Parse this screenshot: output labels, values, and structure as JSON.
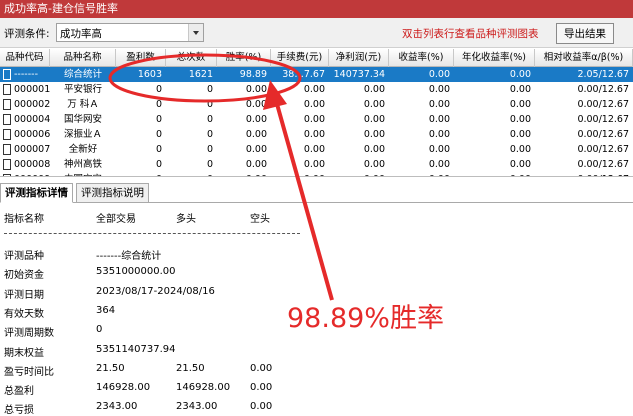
{
  "window": {
    "title": "成功率高-建仓信号胜率"
  },
  "toolbar": {
    "condition_label": "评测条件:",
    "condition_value": "成功率高",
    "hint": "双击列表行查看品种评测图表",
    "export_label": "导出结果"
  },
  "grid": {
    "headers": [
      "品种代码",
      "品种名称",
      "盈利数",
      "总次数",
      "胜率(%)",
      "手续费(元)",
      "净利润(元)",
      "收益率(%)",
      "年化收益率(%)",
      "相对收益率α/β(%)"
    ],
    "rows": [
      [
        "-------",
        "综合统计",
        "1603",
        "1621",
        "98.89",
        "38…7.67",
        "140737.34",
        "0.00",
        "0.00",
        "2.05/12.67"
      ],
      [
        "000001",
        "平安银行",
        "0",
        "0",
        "0.00",
        "0.00",
        "0.00",
        "0.00",
        "0.00",
        "0.00/12.67"
      ],
      [
        "000002",
        "万 科Ａ",
        "0",
        "0",
        "0.00",
        "0.00",
        "0.00",
        "0.00",
        "0.00",
        "0.00/12.67"
      ],
      [
        "000004",
        "国华网安",
        "0",
        "0",
        "0.00",
        "0.00",
        "0.00",
        "0.00",
        "0.00",
        "0.00/12.67"
      ],
      [
        "000006",
        "深振业Ａ",
        "0",
        "0",
        "0.00",
        "0.00",
        "0.00",
        "0.00",
        "0.00",
        "0.00/12.67"
      ],
      [
        "000007",
        "全新好",
        "0",
        "0",
        "0.00",
        "0.00",
        "0.00",
        "0.00",
        "0.00",
        "0.00/12.67"
      ],
      [
        "000008",
        "神州高铁",
        "0",
        "0",
        "0.00",
        "0.00",
        "0.00",
        "0.00",
        "0.00",
        "0.00/12.67"
      ],
      [
        "000009",
        "中国宝安",
        "0",
        "0",
        "0.00",
        "0.00",
        "0.00",
        "0.00",
        "0.00",
        "0.00/12.67"
      ]
    ],
    "selected_row": 0
  },
  "tabs": [
    {
      "label": "评测指标详情",
      "active": true
    },
    {
      "label": "评测指标说明",
      "active": false
    }
  ],
  "detail": {
    "headers": [
      "指标名称",
      "全部交易",
      "多头",
      "空头"
    ],
    "rows": [
      {
        "name": "评测品种",
        "all": "-------综合统计",
        "long": "",
        "short": ""
      },
      {
        "name": "初始资金",
        "all": "5351000000.00",
        "long": "",
        "short": ""
      },
      {
        "name": "评测日期",
        "all": "2023/08/17-2024/08/16",
        "long": "",
        "short": ""
      },
      {
        "name": "有效天数",
        "all": "364",
        "long": "",
        "short": ""
      },
      {
        "name": "评测周期数",
        "all": "0",
        "long": "",
        "short": ""
      },
      {
        "name": "期末权益",
        "all": "5351140737.94",
        "long": "",
        "short": ""
      },
      {
        "name": "盈亏时间比",
        "all": "21.50",
        "long": "21.50",
        "short": "0.00"
      },
      {
        "name": "总盈利",
        "all": "146928.00",
        "long": "146928.00",
        "short": "0.00"
      },
      {
        "name": "总亏损",
        "all": "2343.00",
        "long": "2343.00",
        "short": "0.00"
      }
    ]
  },
  "annotation": {
    "text": "98.89%胜率",
    "color": "#e52a2a"
  },
  "colors": {
    "title_bar": "#c0393a",
    "selection": "#1a7ac6",
    "hint_text": "#cc1a1a"
  },
  "icons": [
    "dropdown-arrow-icon",
    "document-icon"
  ]
}
